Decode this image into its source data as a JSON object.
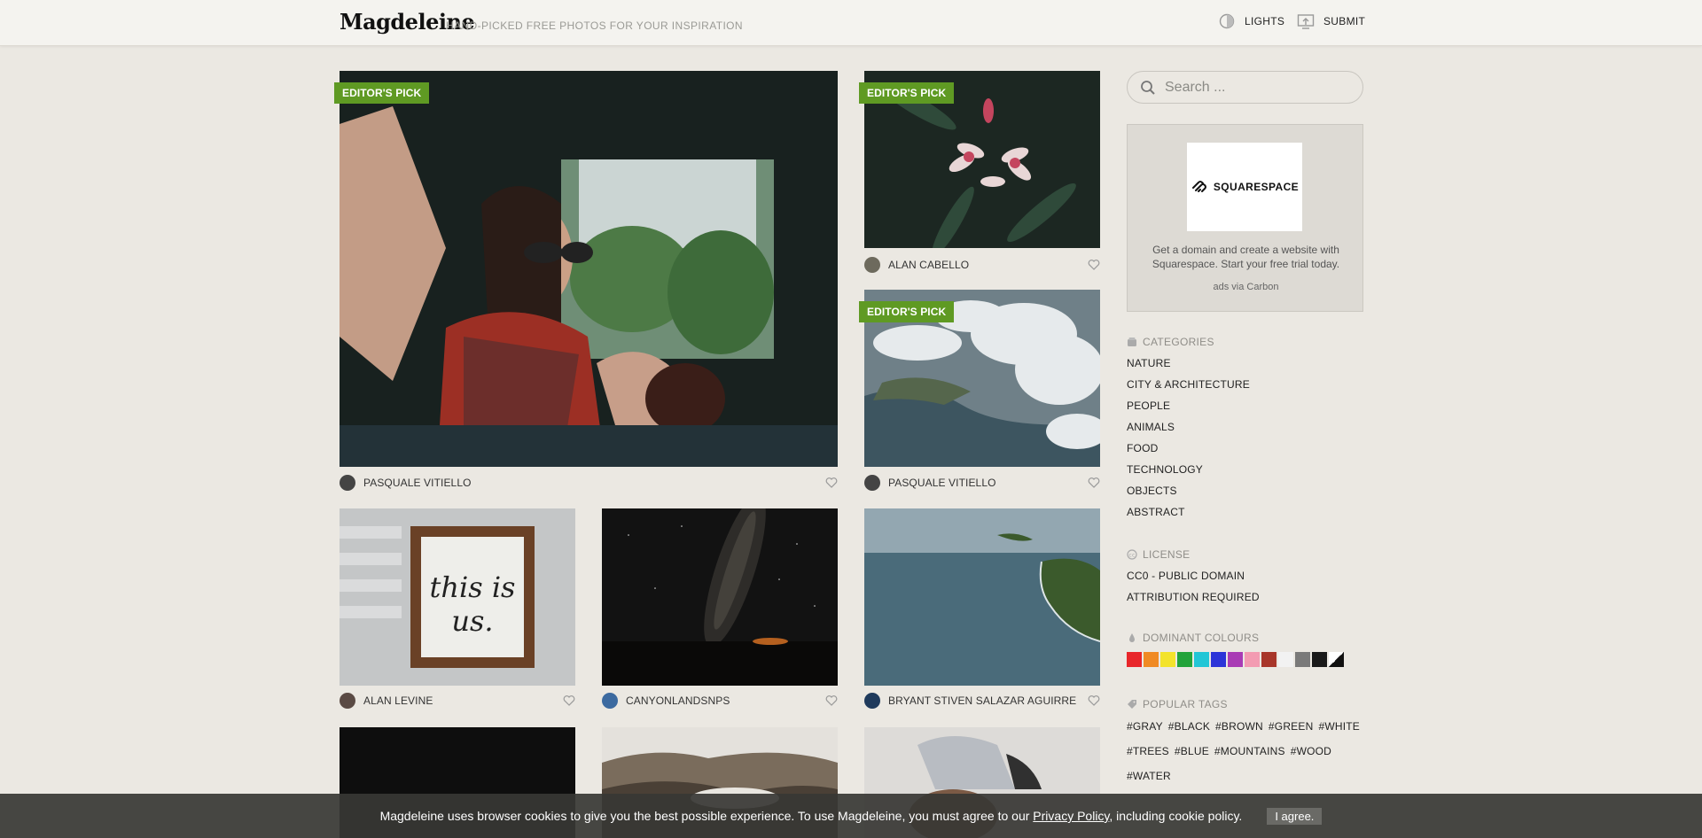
{
  "header": {
    "logo": "Magdeleine",
    "tagline": "HAND-PICKED FREE PHOTOS FOR YOUR INSPIRATION",
    "lights_label": "LIGHTS",
    "submit_label": "SUBMIT"
  },
  "photos": [
    {
      "author": "PASQUALE VITIELLO",
      "badge": "EDITOR'S PICK"
    },
    {
      "author": "ALAN CABELLO",
      "badge": "EDITOR'S PICK"
    },
    {
      "author": "PASQUALE VITIELLO",
      "badge": "EDITOR'S PICK"
    },
    {
      "author": "ALAN LEVINE"
    },
    {
      "author": "CANYONLANDSNPS"
    },
    {
      "author": "BRYANT STIVEN SALAZAR AGUIRRE"
    }
  ],
  "search": {
    "placeholder": "Search ..."
  },
  "ad": {
    "brand": "SQUARESPACE",
    "text": "Get a domain and create a website with Squarespace. Start your free trial today.",
    "via": "ads via Carbon"
  },
  "categories": {
    "title": "CATEGORIES",
    "items": [
      "NATURE",
      "CITY & ARCHITECTURE",
      "PEOPLE",
      "ANIMALS",
      "FOOD",
      "TECHNOLOGY",
      "OBJECTS",
      "ABSTRACT"
    ]
  },
  "license": {
    "title": "LICENSE",
    "items": [
      "CC0 - PUBLIC DOMAIN",
      "ATTRIBUTION REQUIRED"
    ]
  },
  "colours": {
    "title": "DOMINANT COLOURS",
    "swatches": [
      "#e8262a",
      "#f08a24",
      "#f3e32b",
      "#22a33a",
      "#22c6d6",
      "#2c34d8",
      "#a93bb5",
      "#f39bb2",
      "#a8362a",
      "#f2f2f2",
      "#7a7a7a",
      "#1a1a1a",
      "bw"
    ]
  },
  "tags": {
    "title": "POPULAR TAGS",
    "rows": [
      [
        "#GRAY",
        "#BLACK",
        "#BROWN",
        "#GREEN",
        "#WHITE"
      ],
      [
        "#TREES",
        "#BLUE",
        "#MOUNTAINS",
        "#WOOD"
      ],
      [
        "#WATER"
      ]
    ]
  },
  "cookie": {
    "text_before": "Magdeleine uses browser cookies to give you the best possible experience. To use Magdeleine, you must agree to our",
    "link": "Privacy Policy",
    "text_after": ", including cookie policy.",
    "button": "I agree."
  }
}
